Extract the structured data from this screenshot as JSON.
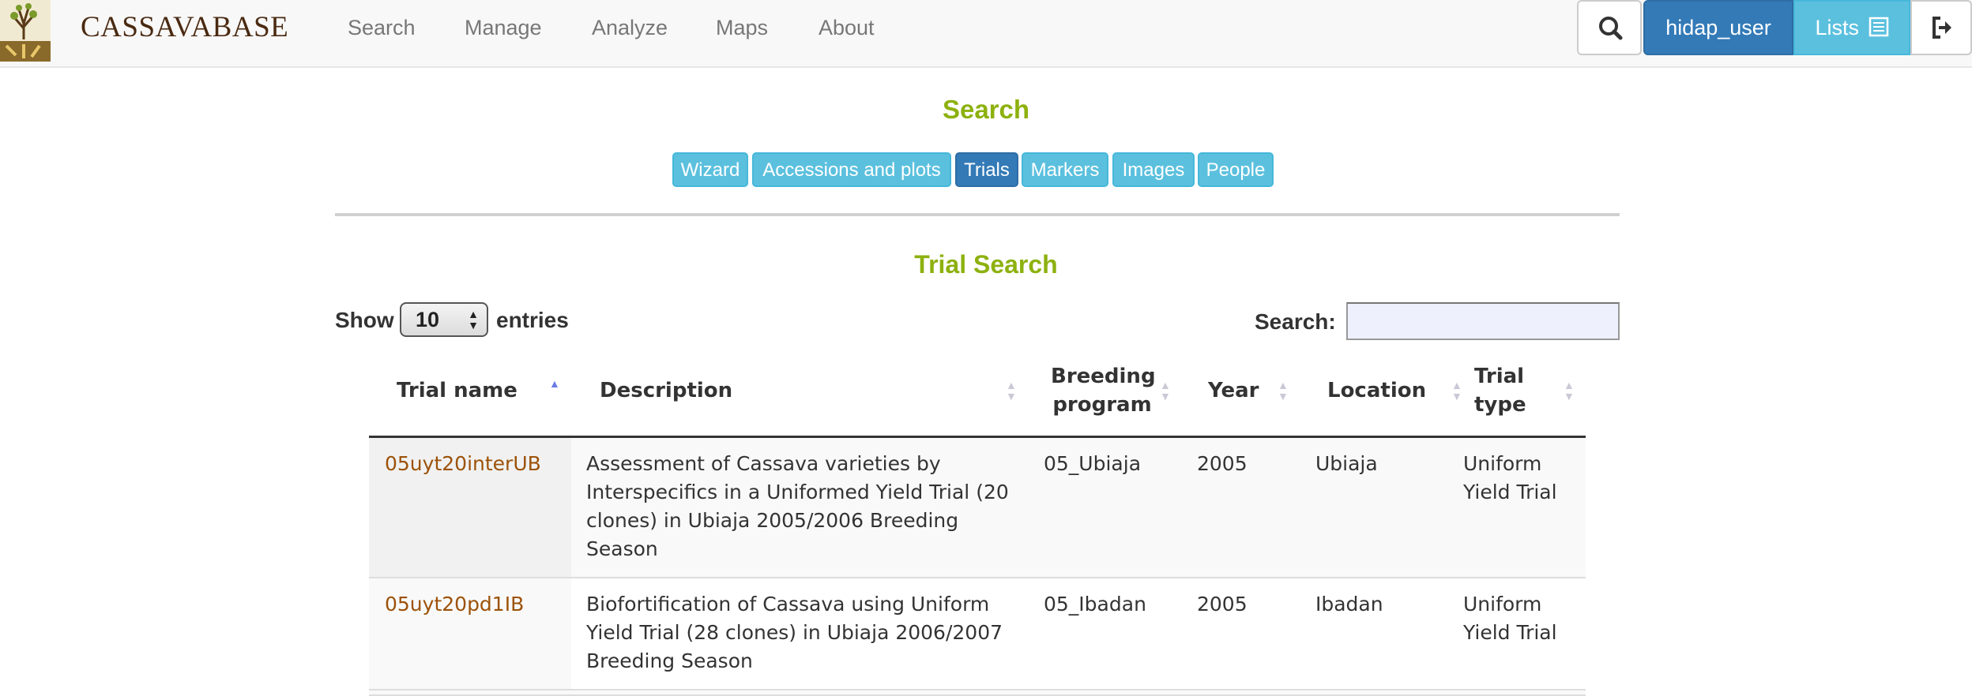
{
  "brand": {
    "name": "CASSAVABASE"
  },
  "nav": {
    "items": [
      "Search",
      "Manage",
      "Analyze",
      "Maps",
      "About"
    ],
    "user": "hidap_user",
    "lists": "Lists"
  },
  "page": {
    "title": "Search",
    "tabs": [
      "Wizard",
      "Accessions and plots",
      "Trials",
      "Markers",
      "Images",
      "People"
    ],
    "active_tab": "Trials",
    "section_title": "Trial Search"
  },
  "table_controls": {
    "show_label": "Show",
    "entries_value": "10",
    "entries_label": "entries",
    "search_label": "Search:",
    "search_value": ""
  },
  "table": {
    "columns": [
      "Trial name",
      "Description",
      "Breeding program",
      "Year",
      "Location",
      "Trial type"
    ],
    "rows": [
      {
        "trial_name": "05uyt20interUB",
        "description": "Assessment of Cassava varieties by Interspecifics in a Uniformed Yield Trial (20 clones) in Ubiaja 2005/2006 Breeding Season",
        "breeding_program": "05_Ubiaja",
        "year": "2005",
        "location": "Ubiaja",
        "trial_type": "Uniform Yield Trial"
      },
      {
        "trial_name": "05uyt20pd1IB",
        "description": "Biofortification of Cassava using Uniform Yield Trial (28 clones) in Ubiaja 2006/2007 Breeding Season",
        "breeding_program": "05_Ibadan",
        "year": "2005",
        "location": "Ibadan",
        "trial_type": "Uniform Yield Trial"
      }
    ]
  },
  "colors": {
    "accent_green": "#8db10e",
    "primary_blue": "#337ab7",
    "info_blue": "#5bc0de",
    "link_brown": "#9c5209"
  },
  "icons": [
    "search-icon",
    "list-icon",
    "logout-icon",
    "sort-icon"
  ]
}
